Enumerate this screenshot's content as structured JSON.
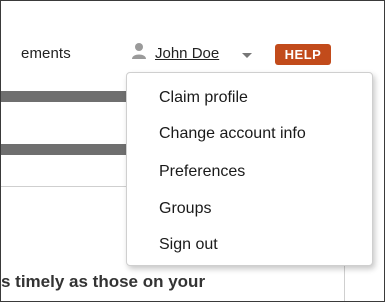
{
  "nav": {
    "partial_label": "ements",
    "user_name": "John Doe",
    "help_label": "HELP"
  },
  "user_menu": {
    "items": [
      {
        "label": "Claim profile"
      },
      {
        "label": "Change account info"
      },
      {
        "label": "Preferences"
      },
      {
        "label": "Groups"
      },
      {
        "label": "Sign out"
      }
    ]
  },
  "content": {
    "text_fragment": "s timely as those on your"
  },
  "colors": {
    "help_bg": "#c24b1b",
    "bar": "#6f6f6f"
  },
  "icons": {
    "user": "user-silhouette",
    "dropdown": "chevron-down"
  }
}
